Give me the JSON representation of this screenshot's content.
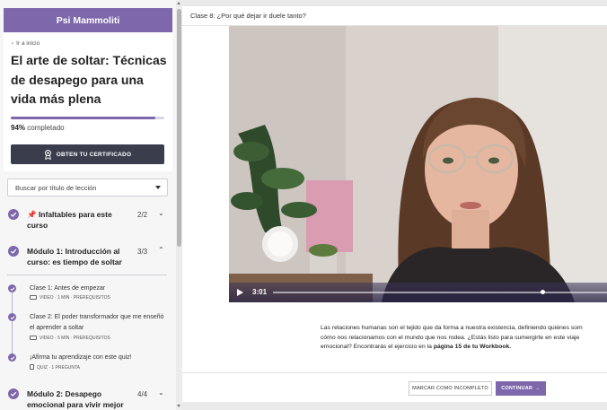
{
  "sidebar": {
    "brand": "Psi Mammoliti",
    "back_link": "Ir a inicio",
    "course_title": "El arte de soltar: Técnicas de desapego para una vida más plena",
    "progress_percent": "94%",
    "progress_value": 0.94,
    "progress_label": "completado",
    "certificate_button": "OBTEN TU CERTIFICADO",
    "search_placeholder": "Buscar por título de lección",
    "sections": [
      {
        "title": "📌 Infaltables para este curso",
        "count": "2/2",
        "expanded": false
      },
      {
        "title": "Módulo 1: Introducción al curso: es tiempo de soltar",
        "count": "3/3",
        "expanded": true
      },
      {
        "title": "Módulo 2: Desapego emocional para vivir mejor",
        "count": "4/4",
        "expanded": false
      }
    ],
    "lessons": [
      {
        "title": "Clase 1: Antes de empezar",
        "meta": "VIDEO · 1 MIN · PREREQUISITOS",
        "kind": "video"
      },
      {
        "title": "Clase 2: El poder transformador que me enseñó el aprender a soltar",
        "meta": "VIDEO · 5 MIN · PREREQUISITOS",
        "kind": "video"
      },
      {
        "title": "¡Afirma tu aprendizaje con este quiz!",
        "meta": "QUIZ · 1 PREGUNTA",
        "kind": "quiz"
      }
    ]
  },
  "main": {
    "lesson_title": "Clase 8: ¿Por qué dejar ir duele tanto?",
    "video": {
      "current_time": "3:01",
      "progress_value": 0.93
    },
    "description": {
      "line1": "Las relaciones humanas son el tejido que da forma a nuestra existencia, definiendo quiénes som",
      "line2": "cómo nos relacionamos con el mundo que nos rodea. ¿Estás listo para sumergirte en este viaje",
      "line3_prefix": "emocional? Encontrarás el ejercicio en la ",
      "line3_bold": "página 15 de tu Workbook."
    },
    "footer": {
      "mark_incomplete": "MARCAR COMO INCOMPLETO",
      "continue": "CONTINUAR",
      "continue_arrow": "→"
    }
  },
  "colors": {
    "accent": "#7e68ab",
    "dark_button": "#3a3d4c"
  }
}
